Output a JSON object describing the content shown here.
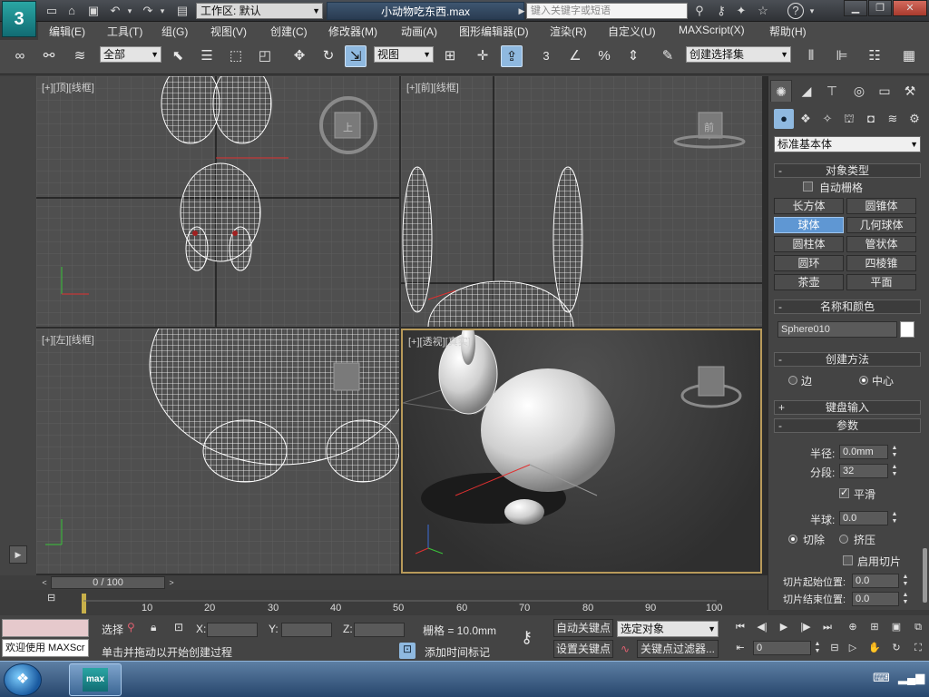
{
  "titlebar": {
    "logo_text": "3",
    "workspace_label": "工作区: 默认",
    "filename": "小动物吃东西.max",
    "search_placeholder": "键入关键字或短语"
  },
  "menu": [
    "编辑(E)",
    "工具(T)",
    "组(G)",
    "视图(V)",
    "创建(C)",
    "修改器(M)",
    "动画(A)",
    "图形编辑器(D)",
    "渲染(R)",
    "自定义(U)",
    "MAXScript(X)",
    "帮助(H)"
  ],
  "toolbar": {
    "selection_filter": "全部",
    "ref_coord": "视图",
    "named_selection": "创建选择集",
    "snap_value": "3"
  },
  "viewports": {
    "top": {
      "label": [
        "[+]",
        "[顶]",
        "[线框]"
      ],
      "cube_text": "上"
    },
    "front": {
      "label": [
        "[+]",
        "[前]",
        "[线框]"
      ],
      "cube_text": "前"
    },
    "left": {
      "label": [
        "[+]",
        "[左]",
        "[线框]"
      ]
    },
    "persp": {
      "label": [
        "[+]",
        "[透视]",
        "[真实]"
      ]
    }
  },
  "command_panel": {
    "category": "标准基本体",
    "object_type": {
      "header": "对象类型",
      "autogrid": "自动栅格",
      "buttons": [
        "长方体",
        "圆锥体",
        "球体",
        "几何球体",
        "圆柱体",
        "管状体",
        "圆环",
        "四棱锥",
        "茶壶",
        "平面"
      ],
      "active": "球体"
    },
    "name_color": {
      "header": "名称和颜色",
      "name": "Sphere010",
      "color": "#ffffff"
    },
    "creation_method": {
      "header": "创建方法",
      "options": [
        "边",
        "中心"
      ],
      "selected": "中心"
    },
    "keyboard_entry": {
      "header": "键盘输入"
    },
    "parameters": {
      "header": "参数",
      "radius_label": "半径:",
      "radius": "0.0mm",
      "segments_label": "分段:",
      "segments": "32",
      "smooth_label": "平滑",
      "hemisphere_label": "半球:",
      "hemisphere": "0.0",
      "chop_label": "切除",
      "squash_label": "挤压",
      "hemi_mode": "切除",
      "slice_label": "启用切片",
      "slice_from_label": "切片起始位置:",
      "slice_from": "0.0",
      "slice_to_label": "切片结束位置:",
      "slice_to": "0.0"
    }
  },
  "timeline": {
    "position": "0 / 100",
    "ticks": [
      "10",
      "20",
      "30",
      "40",
      "50",
      "60",
      "70",
      "80",
      "90",
      "100"
    ]
  },
  "status": {
    "maxscript_prompt": "欢迎使用 MAXScr",
    "selection_label": "选择",
    "x_label": "X:",
    "y_label": "Y:",
    "z_label": "Z:",
    "grid": "栅格 = 10.0mm",
    "prompt": "单击并拖动以开始创建过程",
    "add_time_tag": "添加时间标记",
    "auto_key": "自动关键点",
    "set_key": "设置关键点",
    "key_mode_select": "选定对象",
    "key_filters": "关键点过滤器...",
    "frame": "0"
  },
  "taskbar": {
    "app_label": "max"
  }
}
